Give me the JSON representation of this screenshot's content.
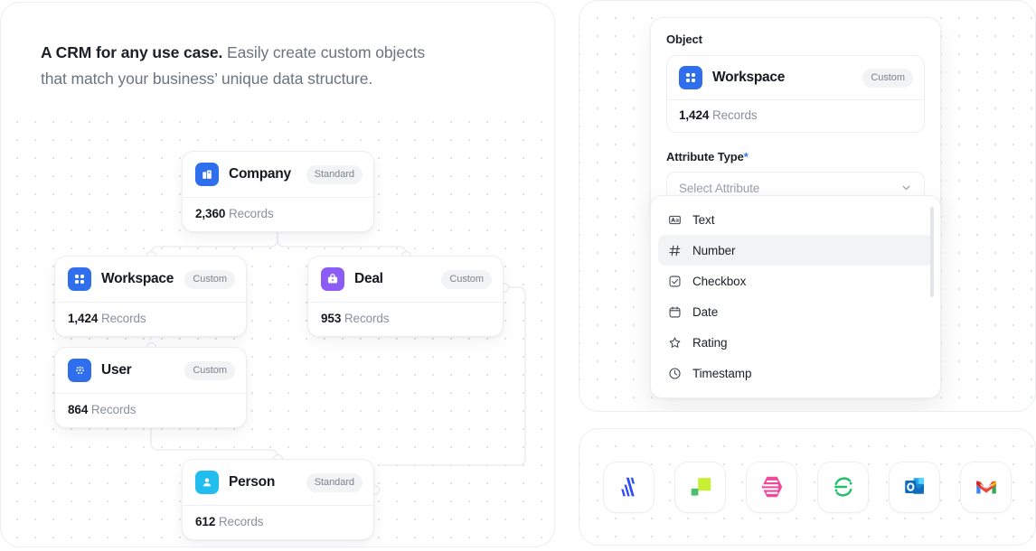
{
  "left": {
    "headline_bold": "A CRM for any use case.",
    "headline_rest": " Easily create custom objects that match your business’ unique data structure.",
    "nodes": [
      {
        "key": "company",
        "name": "Company",
        "badge": "Standard",
        "count": "2,360",
        "unit": "Records",
        "icon": "building-icon",
        "icon_bg": "#2f6fed"
      },
      {
        "key": "workspace",
        "name": "Workspace",
        "badge": "Custom",
        "count": "1,424",
        "unit": "Records",
        "icon": "grid-icon",
        "icon_bg": "#2f6fed"
      },
      {
        "key": "deal",
        "name": "Deal",
        "badge": "Custom",
        "count": "953",
        "unit": "Records",
        "icon": "briefcase-icon",
        "icon_bg": "#8b5cf6"
      },
      {
        "key": "user",
        "name": "User",
        "badge": "Custom",
        "count": "864",
        "unit": "Records",
        "icon": "dots-icon",
        "icon_bg": "#2f6fed"
      },
      {
        "key": "person",
        "name": "Person",
        "badge": "Standard",
        "count": "612",
        "unit": "Records",
        "icon": "person-icon",
        "icon_bg": "#22bdef"
      }
    ]
  },
  "form": {
    "object_label": "Object",
    "object_card": {
      "name": "Workspace",
      "badge": "Custom",
      "count": "1,424",
      "unit": "Records",
      "icon": "grid-icon",
      "icon_bg": "#2f6fed"
    },
    "attribute_label": "Attribute Type",
    "required_mark": "*",
    "select_placeholder": "Select Attribute",
    "chevron": "chevron-down-icon",
    "options": [
      {
        "label": "Text",
        "icon": "text-icon",
        "selected": false
      },
      {
        "label": "Number",
        "icon": "hash-icon",
        "selected": true
      },
      {
        "label": "Checkbox",
        "icon": "checkbox-icon",
        "selected": false
      },
      {
        "label": "Date",
        "icon": "calendar-icon",
        "selected": false
      },
      {
        "label": "Rating",
        "icon": "star-icon",
        "selected": false
      },
      {
        "label": "Timestamp",
        "icon": "clock-icon",
        "selected": false
      }
    ]
  },
  "integrations": [
    {
      "name": "attio-logo",
      "color": "#2f4df0"
    },
    {
      "name": "squares-logo",
      "color": "#c7ef33"
    },
    {
      "name": "hex-logo",
      "color": "#ee4a9b"
    },
    {
      "name": "scribe-logo",
      "color": "#21c16b"
    },
    {
      "name": "outlook-logo",
      "color": "#0f6cbd"
    },
    {
      "name": "gmail-logo",
      "color": "#ea4335"
    }
  ],
  "colors": {
    "accent": "#2f6fed",
    "required": "#3a7bf0",
    "panel_border": "#ebedf0",
    "muted_text": "#8a919b"
  }
}
